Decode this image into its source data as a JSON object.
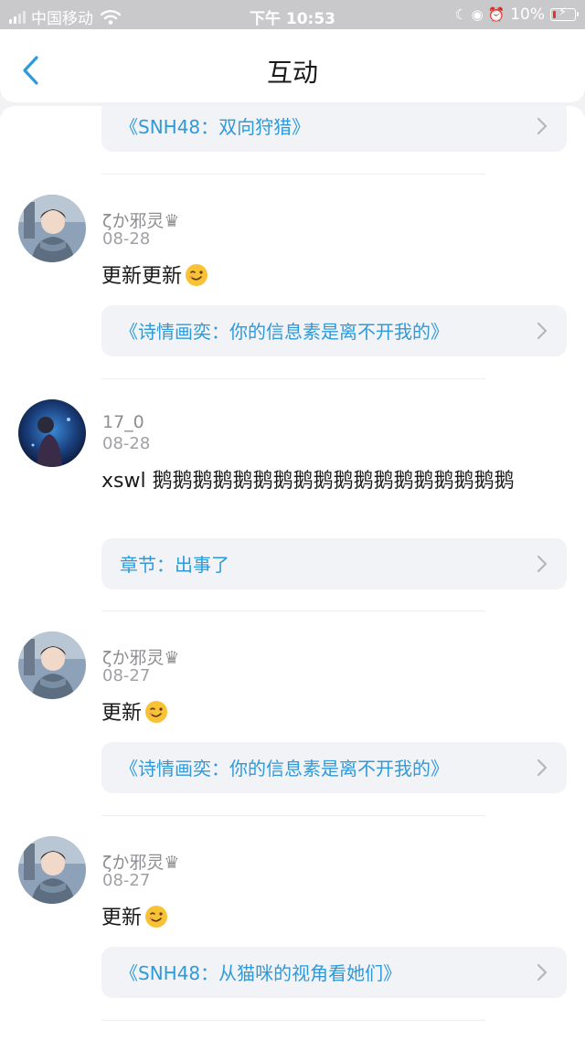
{
  "status_bar": {
    "carrier": "中国移动",
    "wifi_icon": "wifi-icon",
    "time": "下午 10:53",
    "status_icons": "☾ ◉ ⏰",
    "battery": "10%",
    "battery_color": "#e0322e"
  },
  "nav": {
    "back_icon": "chevron-left-icon",
    "title": "互动"
  },
  "top_card": {
    "link": "《SNH48：双向狩猎》"
  },
  "comments": [
    {
      "user": "ζか邪灵♛",
      "date": "08-28",
      "text": "更新更新",
      "has_wink_emoji": true,
      "link": "《诗情画奕：你的信息素是离不开我的》"
    },
    {
      "user": "17_0",
      "date": "08-28",
      "text": "xswl 鹅鹅鹅鹅鹅鹅鹅鹅鹅鹅鹅鹅鹅鹅鹅鹅鹅鹅",
      "has_wink_emoji": false,
      "link": "章节：出事了"
    },
    {
      "user": "ζか邪灵♛",
      "date": "08-27",
      "text": "更新",
      "has_wink_emoji": true,
      "link": "《诗情画奕：你的信息素是离不开我的》"
    },
    {
      "user": "ζか邪灵♛",
      "date": "08-27",
      "text": "更新",
      "has_wink_emoji": true,
      "link": "《SNH48：从猫咪的视角看她们》"
    }
  ],
  "colors": {
    "accent": "#2f9ad9",
    "card_bg": "#f2f3f6",
    "page_bg": "#f2f2f5"
  }
}
